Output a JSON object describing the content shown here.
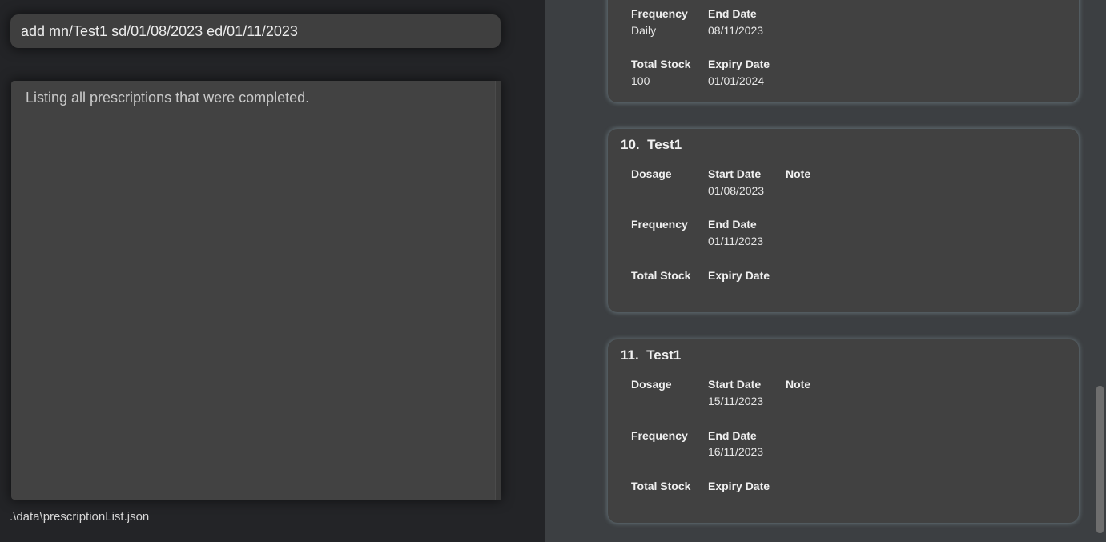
{
  "command_box": {
    "value": "add mn/Test1 sd/01/08/2023 ed/01/11/2023"
  },
  "result_box": {
    "text": "Listing all prescriptions that were completed."
  },
  "status_bar": {
    "path": ".\\data\\prescriptionList.json"
  },
  "labels": {
    "dosage": "Dosage",
    "start_date": "Start Date",
    "note": "Note",
    "frequency": "Frequency",
    "end_date": "End Date",
    "total_stock": "Total Stock",
    "expiry_date": "Expiry Date"
  },
  "cards": [
    {
      "frequency": "Daily",
      "end_date": "08/11/2023",
      "total_stock": "100",
      "expiry_date": "01/01/2024"
    },
    {
      "title": "10.  Test1",
      "start_date": "01/08/2023",
      "end_date": "01/11/2023"
    },
    {
      "title": "11.  Test1",
      "start_date": "15/11/2023",
      "end_date": "16/11/2023"
    }
  ],
  "scrollbar": {
    "position": 0.71
  }
}
